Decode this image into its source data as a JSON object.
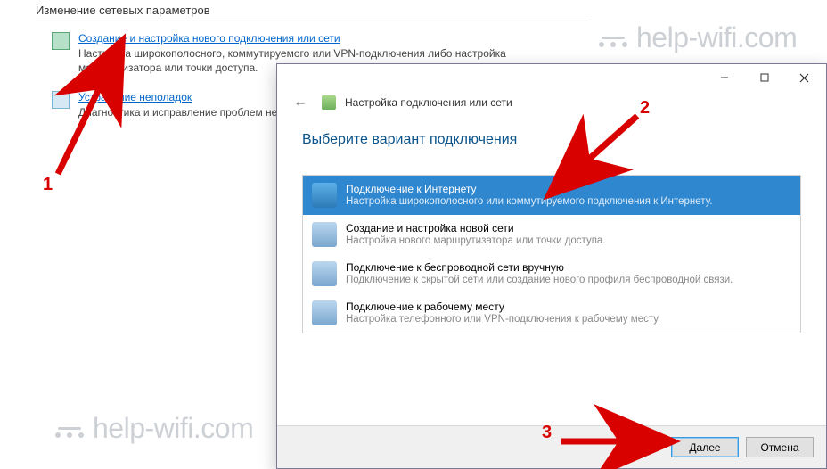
{
  "bg": {
    "section_title": "Изменение сетевых параметров",
    "item1_link": "Создание и настройка нового подключения или сети",
    "item1_desc": "Настройка широкополосного, коммутируемого или VPN-подключения либо настройка маршрутизатора или точки доступа.",
    "item2_link": "Устранение неполадок",
    "item2_desc": "Диагностика и исправление проблем неполадок."
  },
  "dialog": {
    "header": "Настройка подключения или сети",
    "heading": "Выберите вариант подключения",
    "options": [
      {
        "title": "Подключение к Интернету",
        "desc": "Настройка широкополосного или коммутируемого подключения к Интернету."
      },
      {
        "title": "Создание и настройка новой сети",
        "desc": "Настройка нового маршрутизатора или точки доступа."
      },
      {
        "title": "Подключение к беспроводной сети вручную",
        "desc": "Подключение к скрытой сети или создание нового профиля беспроводной связи."
      },
      {
        "title": "Подключение к рабочему месту",
        "desc": "Настройка телефонного или VPN-подключения к рабочему месту."
      }
    ],
    "btn_next": "Далее",
    "btn_cancel": "Отмена"
  },
  "watermark": "help-wifi.com",
  "annot": {
    "n1": "1",
    "n2": "2",
    "n3": "3"
  }
}
